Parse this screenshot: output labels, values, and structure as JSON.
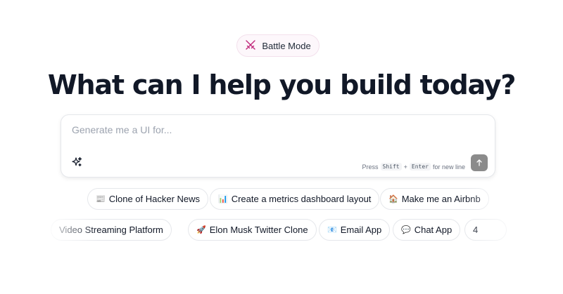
{
  "badge": {
    "label": "Battle Mode",
    "icon": "crossed-swords-icon",
    "color": "#c0267a"
  },
  "headline": "What can I help you build today?",
  "prompt": {
    "placeholder": "Generate me a UI for...",
    "value": "",
    "hint_press": "Press",
    "hint_key1": "Shift",
    "hint_plus": "+",
    "hint_key2": "Enter",
    "hint_suffix": "for new line",
    "send_color": "#8b8b8b"
  },
  "chips_row1": [
    {
      "emoji": "📰",
      "label": "Clone of Hacker News"
    },
    {
      "emoji": "📊",
      "label": "Create a metrics dashboard layout"
    },
    {
      "emoji": "🏠",
      "label": "Make me an Airbnb"
    }
  ],
  "chips_row2": [
    {
      "emoji": "",
      "label": "Video Streaming Platform"
    },
    {
      "emoji": "🚀",
      "label": "Elon Musk Twitter Clone"
    },
    {
      "emoji": "📧",
      "label": "Email App"
    },
    {
      "emoji": "💬",
      "label": "Chat App"
    },
    {
      "emoji": "",
      "label": "4"
    }
  ]
}
